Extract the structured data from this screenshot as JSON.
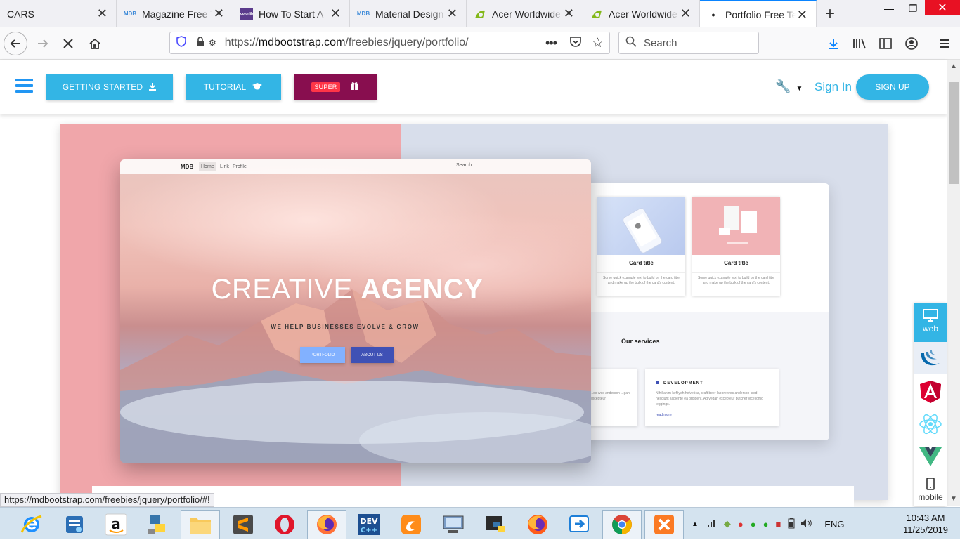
{
  "tabs": [
    {
      "title": "CARS",
      "favicon": "none"
    },
    {
      "title": "Magazine Free Template",
      "favicon": "mdb-logo"
    },
    {
      "title": "How To Start A",
      "favicon": "colorlib-logo"
    },
    {
      "title": "Material Design",
      "favicon": "mdb-logo"
    },
    {
      "title": "Acer Worldwide",
      "favicon": "acer-logo"
    },
    {
      "title": "Acer Worldwide",
      "favicon": "acer-logo"
    },
    {
      "title": "Portfolio Free Template",
      "favicon": "loading-dot"
    }
  ],
  "favicon_text": {
    "mdb": "MDB",
    "colorlib": "colorlib"
  },
  "nav": {
    "url_host": "mdbootstrap.com",
    "url_prefix": "https://",
    "url_path": "/freebies/jquery/portfolio/",
    "search_placeholder": "Search"
  },
  "site_header": {
    "getting_started": "GETTING STARTED",
    "tutorial": "TUTORIAL",
    "super_badge": "SUPER",
    "sign_in": "Sign In",
    "sign_up": "SIGN UP"
  },
  "mockup": {
    "brand": "MDB",
    "links": [
      "Home",
      "Link",
      "Profile"
    ],
    "search": "Search",
    "title_light": "CREATIVE ",
    "title_bold": "AGENCY",
    "subtitle": "WE HELP BUSINESSES EVOLVE & GROW",
    "btn_portfolio": "PORTFOLIO",
    "btn_about": "ABOUT US"
  },
  "back_mockup": {
    "cards": [
      {
        "title": "Card title",
        "text": "Some quick example text to build on the card title and make up the bulk of the card's content."
      },
      {
        "title": "Card title",
        "text": "Some quick example text to build on the card title and make up the bulk of the card's content."
      }
    ],
    "services_title": "Our services",
    "left_card_text": "...es wes anderson ...gan excepteur",
    "dev_title": "DEVELOPMENT",
    "dev_text": "Nihil anim keffiyeh helvetica, craft beer labore wes anderson cred nesciunt sapiente ea proident. Ad vegan excepteur butcher vice lomo leggings.",
    "read_more": "read more"
  },
  "framework_bar": {
    "web": "web",
    "mobile": "mobile",
    "items": [
      "jquery-icon",
      "angular-icon",
      "react-icon",
      "vue-icon"
    ]
  },
  "status_url": "https://mdbootstrap.com/freebies/jquery/portfolio/#!",
  "taskbar": {
    "language": "ENG",
    "time": "10:43 AM",
    "date": "11/25/2019"
  },
  "colors": {
    "accent": "#33b5e5",
    "super": "#880e4f",
    "indigo": "#3f51b5",
    "pink_bg": "#f0a6aa",
    "blue_bg": "#d8deeb"
  }
}
